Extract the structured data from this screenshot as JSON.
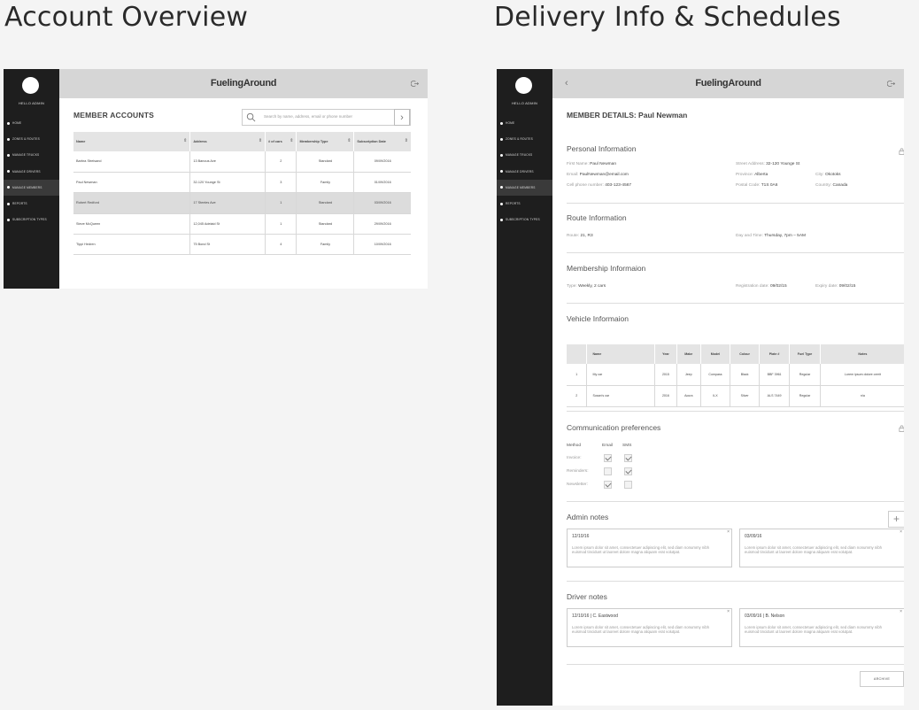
{
  "titles": {
    "left": "Account Overview",
    "right": "Delivery Info & Schedules"
  },
  "sidebar": {
    "greeting": "HELLO ADMIN",
    "items": [
      "HOME",
      "ZONES & ROUTES",
      "MANAGE TRUCKS",
      "MANAGE DRIVERS",
      "MANAGE MEMBERS",
      "REPORTS",
      "SUBSCRIPTION TYPES"
    ],
    "active_index": 4
  },
  "brand": "FuelingAround",
  "accounts": {
    "title": "MEMBER ACCOUNTS",
    "search_placeholder": "Search by name, address, email or phone number",
    "columns": [
      "Name",
      "Address",
      "# of cars",
      "Membership Type",
      "Subscription Date"
    ],
    "rows": [
      [
        "Barbra Streisand",
        "13 Banous Ave",
        "2",
        "Standard",
        "09/09/2016"
      ],
      [
        "Paul Newman",
        "32-120 Younge St",
        "3",
        "Family",
        "01/09/2016"
      ],
      [
        "Robert Redford",
        "17 Steeles Ave",
        "1",
        "Standard",
        "03/09/2016"
      ],
      [
        "Steve McQueen",
        "12,045 Adelaid St",
        "1",
        "Standard",
        "29/09/2016"
      ],
      [
        "Tippi Hedren",
        "75 Bond St",
        "4",
        "Family",
        "10/09/2016"
      ]
    ],
    "selected_row": 2
  },
  "details": {
    "title": "MEMBER DETAILS: Paul Newman",
    "personal": {
      "heading": "Personal Information",
      "first_name_label": "First Name:",
      "first_name": "Paul Newman",
      "email_label": "Email:",
      "email": "PaulNewman@email.com",
      "phone_label": "Cell phone number:",
      "phone": "403-123-4567",
      "street_label": "Street Address:",
      "street": "32-120 Younge St",
      "province_label": "Province:",
      "province": "Alberta",
      "city_label": "City:",
      "city": "Okotoks",
      "postal_label": "Postal Code:",
      "postal": "T1S 0A6",
      "country_label": "Country:",
      "country": "Canada"
    },
    "route": {
      "heading": "Route Information",
      "route_label": "Route:",
      "route": "21, R3",
      "day_label": "Day and Time:",
      "day": "Thursday, 7pm – 5AM"
    },
    "membership": {
      "heading": "Membership Informaion",
      "type_label": "Type:",
      "type": "Weekly, 2 cars",
      "reg_label": "Registration date:",
      "reg": "09/02/15",
      "exp_label": "Expiry date:",
      "exp": "09/02/15"
    },
    "vehicle": {
      "heading": "Vehicle Informaion",
      "columns": [
        "",
        "Name",
        "Year",
        "Make",
        "Model",
        "Colour",
        "Plate #",
        "Fuel Type",
        "Notes"
      ],
      "rows": [
        [
          "1",
          "My car",
          "2015",
          "Jeep",
          "Compass",
          "Black",
          "BBF 3961",
          "Regular",
          "Lorem ipsum dolore orerit"
        ],
        [
          "2",
          "Susan's car",
          "2016",
          "Acura",
          "ILX",
          "Silver",
          "ALS 7449",
          "Regular",
          "n/a"
        ]
      ]
    },
    "comm": {
      "heading": "Communication preferences",
      "method_label": "Method",
      "email_label": "Email",
      "sms_label": "SMS",
      "rows": [
        {
          "label": "Invoice:",
          "email": true,
          "sms": true
        },
        {
          "label": "Reminders:",
          "email": false,
          "sms": true
        },
        {
          "label": "Newsletter:",
          "email": true,
          "sms": false
        }
      ]
    },
    "admin_notes": {
      "heading": "Admin notes",
      "plus": "+",
      "notes": [
        {
          "date": "12/10/16",
          "text": "Lorem ipsum dolor sit amet, consectetuer adipiscing elit, sed diam nonummy nibh euismod tincidunt ut laoreet dolore magna aliquam erat volutpat."
        },
        {
          "date": "03/09/16",
          "text": "Lorem ipsum dolor sit amet, consectetuer adipiscing elit, sed diam nonummy nibh euismod tincidunt ut laoreet dolore magna aliquam erat volutpat."
        }
      ]
    },
    "driver_notes": {
      "heading": "Driver notes",
      "notes": [
        {
          "date": "12/10/16   |   C. Eastwood",
          "text": "Lorem ipsum dolor sit amet, consectetuer adipiscing elit, sed diam nonummy nibh euismod tincidunt ut laoreet dolore magna aliquam erat volutpat."
        },
        {
          "date": "03/09/16   |   B. Nelson",
          "text": "Lorem ipsum dolor sit amet, consectetuer adipiscing elit, sed diam nonummy nibh euismod tincidunt ut laoreet dolore magna aliquam erat volutpat."
        }
      ]
    },
    "archive": "ARCHIVE",
    "close": "×",
    "back": "‹"
  }
}
